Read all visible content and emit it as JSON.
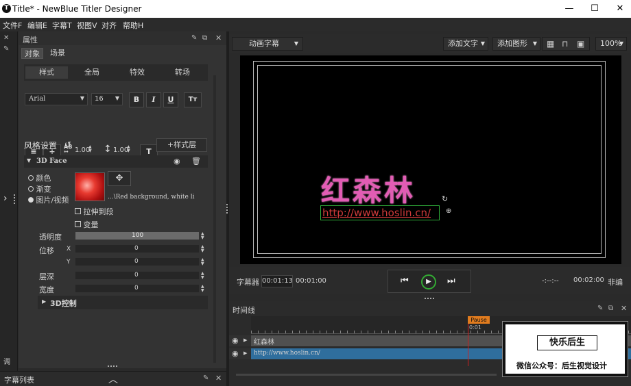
{
  "window": {
    "title": "Title* - NewBlue Titler Designer",
    "app_icon_glyph": "T"
  },
  "menu": [
    "文件F",
    "编辑E",
    "字幕T",
    "视图V",
    "对齐",
    "帮助H"
  ],
  "props": {
    "title": "属性",
    "tabs": [
      "对象",
      "场景"
    ],
    "subtabs": [
      "样式",
      "全局",
      "特效",
      "转场"
    ],
    "font_name": "Arial",
    "font_size": "16",
    "bold": "B",
    "italic": "I",
    "underline": "U",
    "case": "Tт",
    "align_glyph": "≡",
    "valign_glyph": "÷",
    "ab_label": "AB",
    "ab_value": "1.00",
    "line_value": "1.00",
    "t_glyph": "T",
    "style_heading": "风格设置",
    "add_layer": "+样式层",
    "face_name": "3D Face",
    "fill_options": [
      "颜色",
      "渐变",
      "图片/视频"
    ],
    "image_path": "...\\Red background, white li",
    "stretch": "拉伸到段",
    "transform": "变量",
    "opacity_label": "透明度",
    "opacity_value": "100",
    "offset_label": "位移",
    "x_label": "X",
    "x_value": "0",
    "y_label": "Y",
    "y_value": "0",
    "depth_label": "层深",
    "depth_value": "0",
    "width_label": "宽度",
    "width_value": "0",
    "control3d": "3D控制"
  },
  "left_strip_label": "调",
  "caption_list": "字幕列表",
  "viewer": {
    "mode": "动画字幕",
    "add_text": "添加文字",
    "add_shape": "添加图形",
    "zoom": "100%",
    "title_text": "红森林",
    "url_text": "http://www.hoslin.cn/",
    "caption_label": "字幕器",
    "time_current": "00:01:13",
    "time_alt": "00:01:00",
    "time_mark": "-:--:--",
    "time_total": "00:02:00",
    "mode_right": "非编"
  },
  "timeline": {
    "title": "时间线",
    "pause": "Pause",
    "cursor_time": "0:01",
    "tracks": [
      "红森林",
      "http://www.hoslin.cn/"
    ],
    "minus": "−",
    "plus": "+"
  },
  "watermark": {
    "line1": "快乐后生",
    "line2": "微信公众号：后生视觉设计"
  },
  "colors": {
    "accent": "#2f6fa5",
    "track_blue": "#2f6e9d",
    "pause": "#e07b1e",
    "playhead": "#d01f1f",
    "title_pink": "#e060b0",
    "ok_green": "#33aa33"
  }
}
